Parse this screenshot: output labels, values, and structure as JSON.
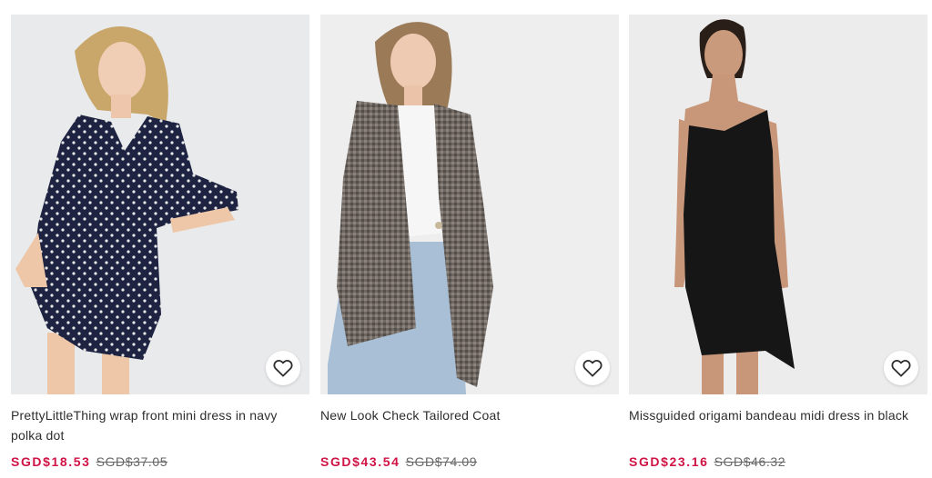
{
  "colors": {
    "sale_price": "#d01345",
    "was_price": "#666666",
    "title_text": "#2d2d2d",
    "image_background": "#ebebeb"
  },
  "products": [
    {
      "title": "PrettyLittleThing wrap front mini dress in navy polka dot",
      "sale_price": "SGD$18.53",
      "original_price": "SGD$37.05",
      "save_icon": "heart-outline-icon"
    },
    {
      "title": "New Look Check Tailored Coat",
      "sale_price": "SGD$43.54",
      "original_price": "SGD$74.09",
      "save_icon": "heart-outline-icon"
    },
    {
      "title": "Missguided origami bandeau midi dress in black",
      "sale_price": "SGD$23.16",
      "original_price": "SGD$46.32",
      "save_icon": "heart-outline-icon"
    }
  ]
}
